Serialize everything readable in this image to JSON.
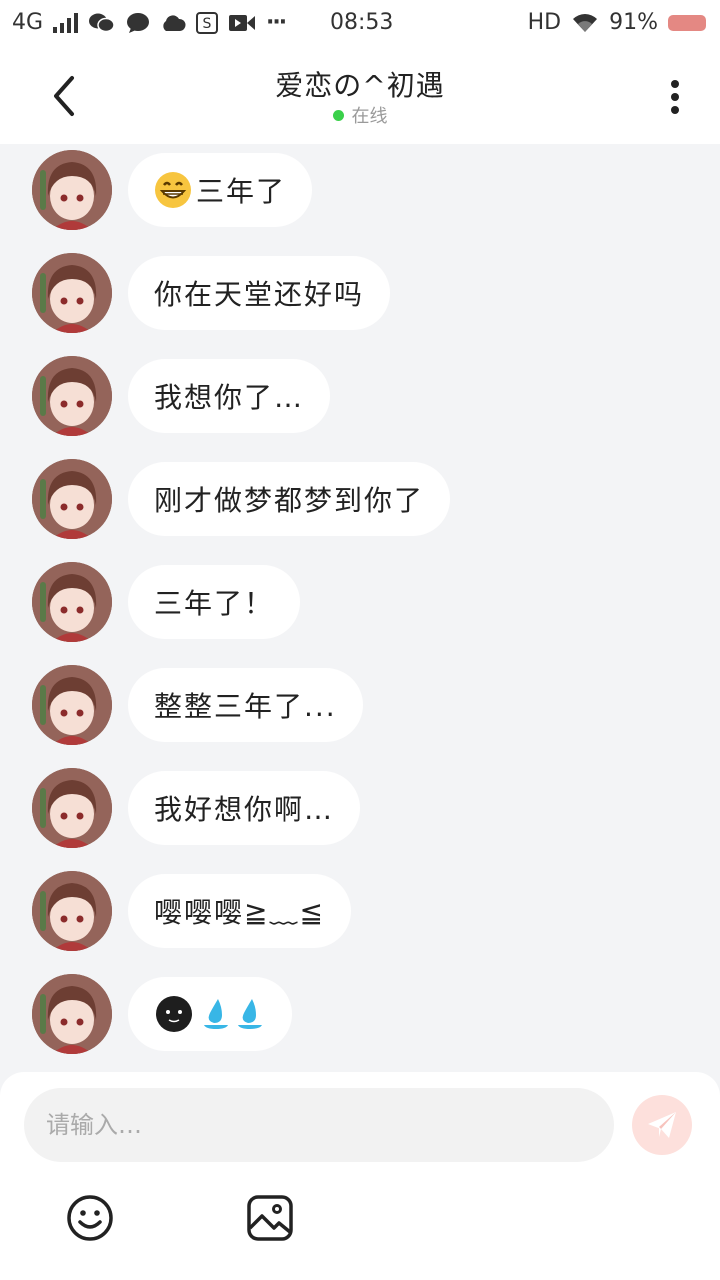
{
  "status_bar": {
    "network": "4G",
    "time": "08:53",
    "hd": "HD",
    "battery": "91%",
    "more": "···"
  },
  "header": {
    "title": "爱恋の^初遇",
    "status": "在线"
  },
  "messages": [
    {
      "emoji": "😁",
      "text": "三年了"
    },
    {
      "text": "你在天堂还好吗"
    },
    {
      "text": "我想你了…"
    },
    {
      "text": "刚才做梦都梦到你了"
    },
    {
      "text": "三年了！"
    },
    {
      "text": "整整三年了..."
    },
    {
      "text": "我好想你啊…"
    },
    {
      "text": "嘤嘤嘤≧﹏≦"
    },
    {
      "text": ""
    }
  ],
  "input": {
    "placeholder": "请输入…",
    "value": ""
  },
  "colors": {
    "accent": "#f06e61",
    "online": "#3ad04a",
    "background": "#f3f4f6",
    "bubble": "#ffffff"
  },
  "icons": [
    "back-icon",
    "more-icon",
    "send-icon",
    "smile-icon",
    "image-icon",
    "wifi-icon",
    "battery-icon"
  ]
}
